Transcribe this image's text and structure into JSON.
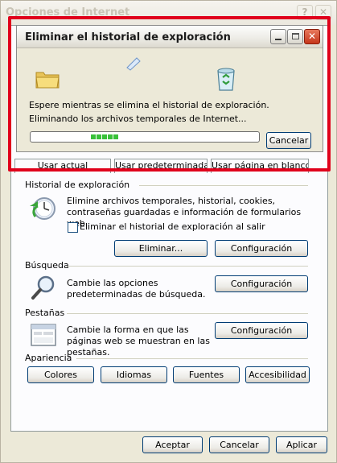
{
  "outer_window": {
    "title": "Opciones de Internet",
    "help_label": "?",
    "close_label": "✕"
  },
  "tabs": [
    "Usar actual",
    "Usar predeterminada",
    "Usar página en blanco"
  ],
  "browsing_history": {
    "title": "Historial de exploración",
    "description": "Elimine archivos temporales, historial, cookies, contraseñas guardadas e información de formularios web.",
    "checkbox_label": "Eliminar el historial de exploración al salir",
    "checkbox_checked": false,
    "delete_button": "Eliminar...",
    "settings_button": "Configuración"
  },
  "search": {
    "title": "Búsqueda",
    "description": "Cambie las opciones predeterminadas de búsqueda.",
    "settings_button": "Configuración"
  },
  "tabs_section": {
    "title": "Pestañas",
    "description": "Cambie la forma en que las páginas web se muestran en las pestañas.",
    "settings_button": "Configuración"
  },
  "appearance": {
    "title": "Apariencia",
    "buttons": [
      "Colores",
      "Idiomas",
      "Fuentes",
      "Accesibilidad"
    ]
  },
  "footer": {
    "ok": "Aceptar",
    "cancel": "Cancelar",
    "apply": "Aplicar"
  },
  "dialog": {
    "title": "Eliminar el historial de exploración",
    "message": "Espere mientras se elimina el historial de exploración.",
    "status": "Eliminando los archivos temporales de Internet...",
    "cancel_button": "Cancelar",
    "progress_blocks": 5
  },
  "colors": {
    "highlight": "#e0001b",
    "progress": "#39c139",
    "button_border": "#003c74"
  },
  "icons": [
    "folder-icon",
    "flying-paper-icon",
    "recycle-bin-icon",
    "history-clock-icon",
    "magnifier-icon",
    "tabs-window-icon"
  ]
}
